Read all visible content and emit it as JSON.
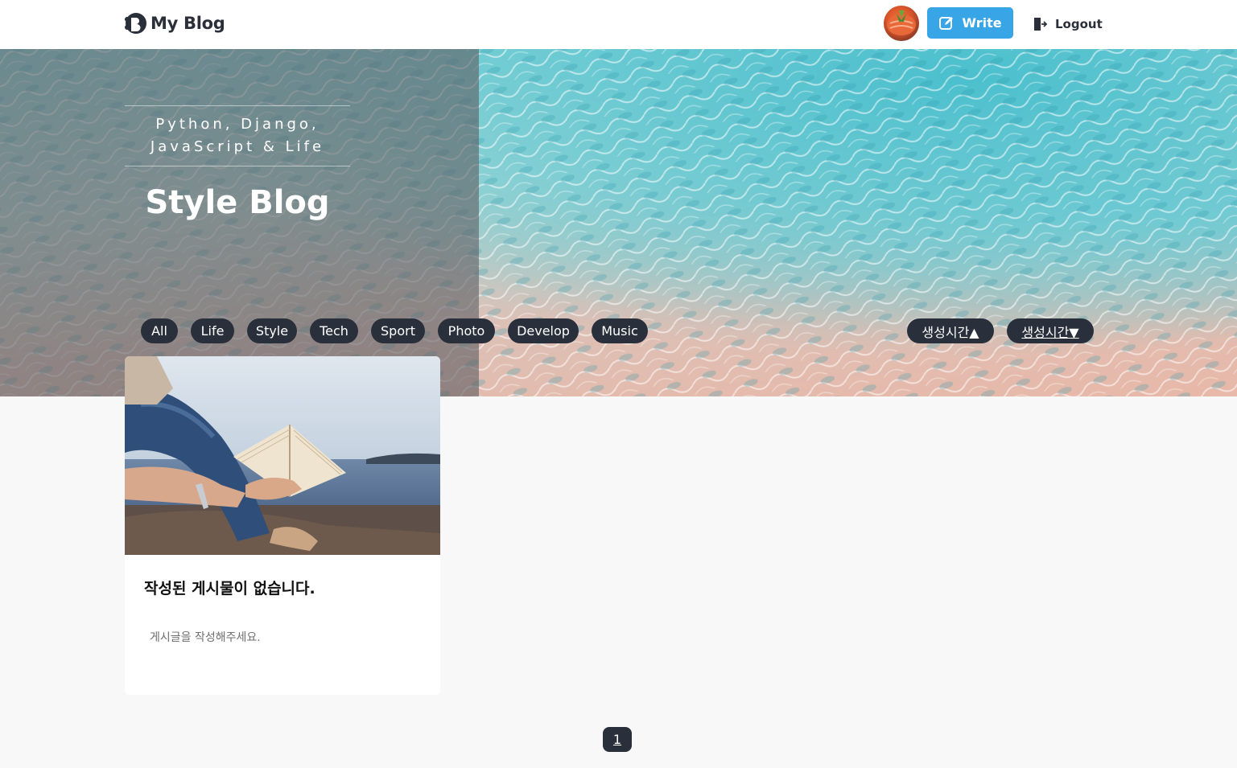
{
  "header": {
    "logo_text": "My Blog",
    "write_label": "Write",
    "logout_label": "Logout"
  },
  "hero": {
    "tagline_line1": "Python, Django,",
    "tagline_line2": "JavaScript & Life",
    "title": "Style Blog"
  },
  "categories": {
    "items": [
      "All",
      "Life",
      "Style",
      "Tech",
      "Sport",
      "Photo",
      "Develop",
      "Music"
    ]
  },
  "sort": {
    "asc_label": "생성시간▲",
    "desc_label": "생성시간▼"
  },
  "card": {
    "title": "작성된 게시물이 없습니다.",
    "body": "게시글을 작성해주세요."
  },
  "pagination": {
    "current": "1"
  },
  "colors": {
    "accent": "#37a5e6",
    "chip_bg": "#2a2f3c",
    "text_dark": "#2b2f3a",
    "page_bg": "#f8f8f8"
  }
}
